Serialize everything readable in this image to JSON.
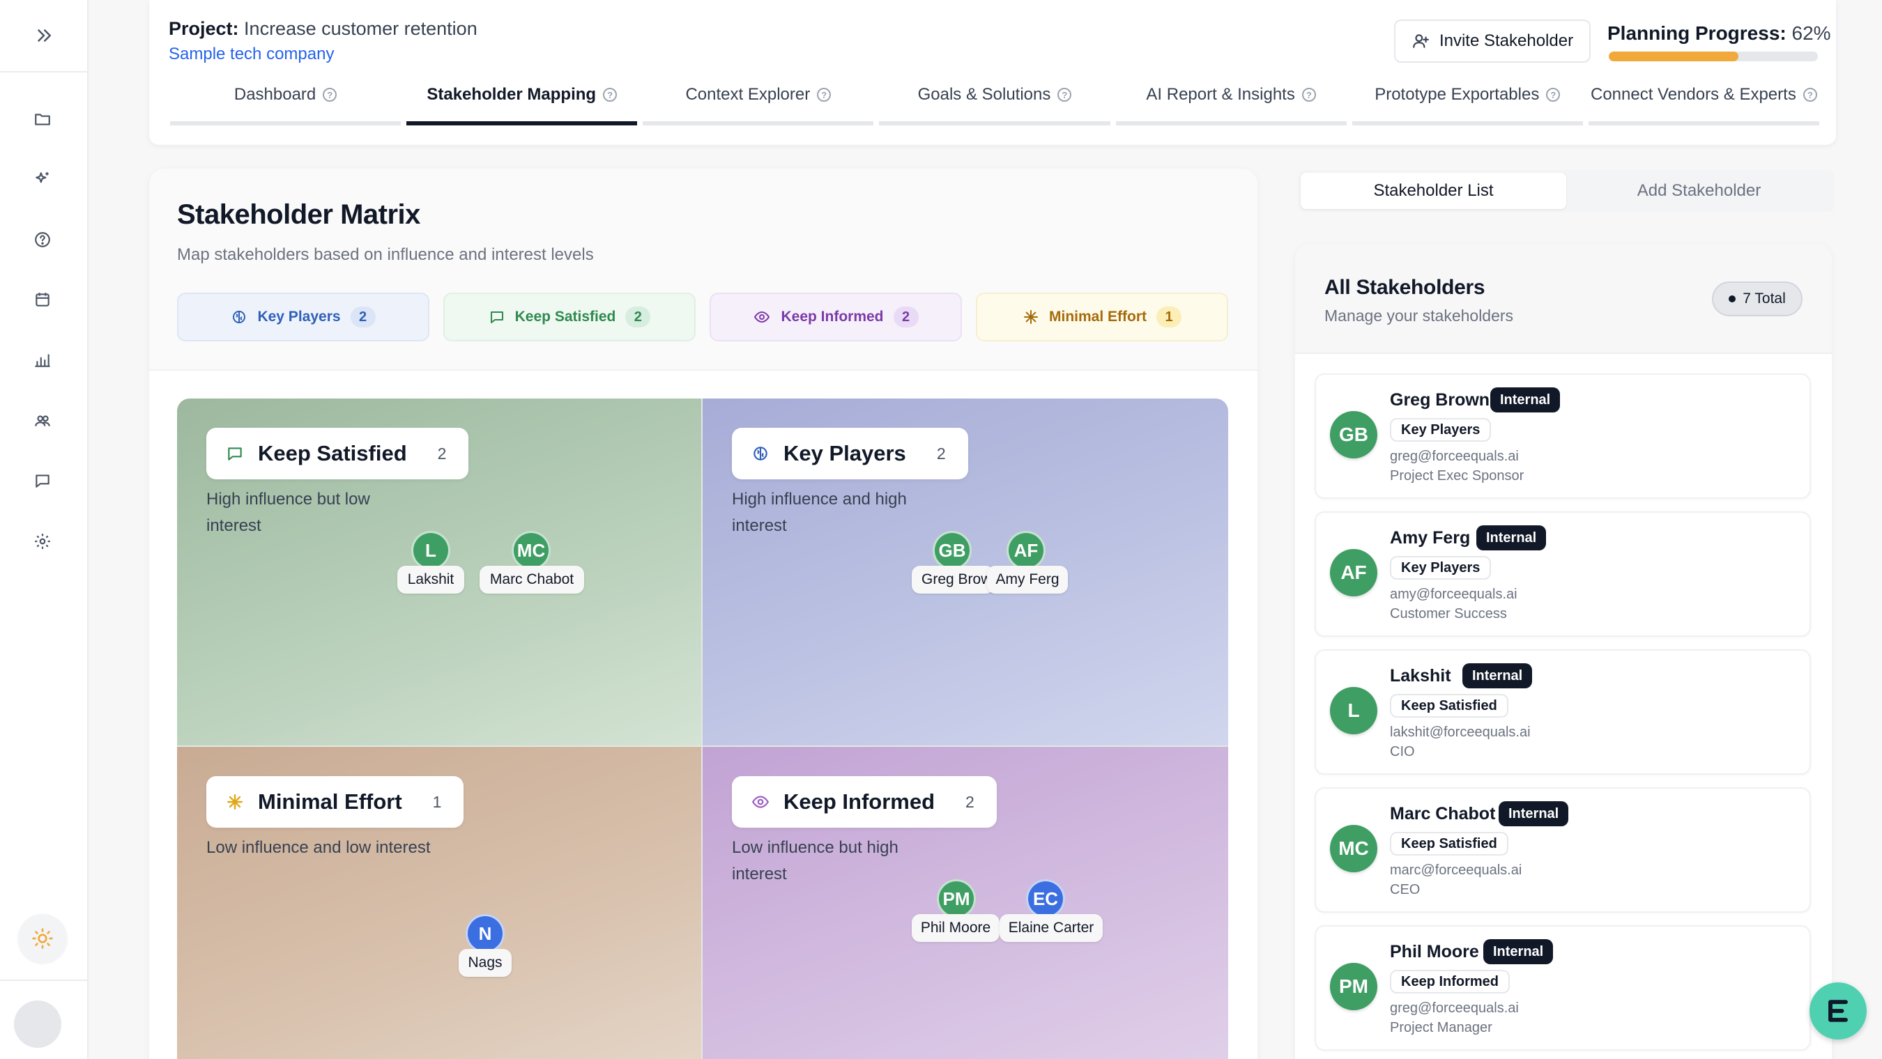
{
  "sidebar": {
    "items": [
      {
        "icon": "folder-icon"
      },
      {
        "icon": "sparkle-icon"
      },
      {
        "icon": "help-icon"
      },
      {
        "icon": "calendar-icon"
      },
      {
        "icon": "bar-chart-icon"
      },
      {
        "icon": "users-icon"
      },
      {
        "icon": "chat-icon"
      },
      {
        "icon": "settings-icon"
      }
    ]
  },
  "header": {
    "project_label": "Project:",
    "project_name": "Increase customer retention",
    "company": "Sample tech company",
    "invite_label": "Invite Stakeholder",
    "progress_label": "Planning Progress:",
    "progress_value": "62%",
    "progress_fraction": 0.62,
    "progress_color": "#f0a93a"
  },
  "tabs": [
    {
      "label": "Dashboard",
      "active": false
    },
    {
      "label": "Stakeholder Mapping",
      "active": true
    },
    {
      "label": "Context Explorer",
      "active": false
    },
    {
      "label": "Goals & Solutions",
      "active": false
    },
    {
      "label": "AI Report & Insights",
      "active": false
    },
    {
      "label": "Prototype Exportables",
      "active": false
    },
    {
      "label": "Connect Vendors & Experts",
      "active": false
    }
  ],
  "matrix": {
    "title": "Stakeholder Matrix",
    "subtitle": "Map stakeholders based on influence and interest levels",
    "pills": [
      {
        "label": "Key Players",
        "count": "2",
        "color": "#2f5fb8",
        "bg": "#eef3fb",
        "border": "#dde6f5",
        "cnt_bg": "#dbe5f7"
      },
      {
        "label": "Keep Satisfied",
        "count": "2",
        "color": "#2f8a4e",
        "bg": "#eff8f1",
        "border": "#dff0e3",
        "cnt_bg": "#d6ede0"
      },
      {
        "label": "Keep Informed",
        "count": "2",
        "color": "#7b3aa8",
        "bg": "#f6f0fb",
        "border": "#ebe1f4",
        "cnt_bg": "#e9dbf5"
      },
      {
        "label": "Minimal Effort",
        "count": "1",
        "color": "#a66a0b",
        "bg": "#fefbea",
        "border": "#f6efcf",
        "cnt_bg": "#fbeeb6"
      }
    ],
    "quadrants": {
      "keep_satisfied": {
        "title": "Keep Satisfied",
        "count": "2",
        "desc": "High influence but low interest",
        "people": [
          {
            "initials": "L",
            "name": "Lakshit"
          },
          {
            "initials": "MC",
            "name": "Marc Chabot"
          }
        ]
      },
      "key_players": {
        "title": "Key Players",
        "count": "2",
        "desc": "High influence and high interest",
        "people": [
          {
            "initials": "GB",
            "name": "Greg Brown"
          },
          {
            "initials": "AF",
            "name": "Amy Ferg"
          }
        ]
      },
      "minimal_effort": {
        "title": "Minimal Effort",
        "count": "1",
        "desc": "Low influence and low interest",
        "people": [
          {
            "initials": "N",
            "name": "Nags"
          }
        ]
      },
      "keep_informed": {
        "title": "Keep Informed",
        "count": "2",
        "desc": "Low influence but high interest",
        "people": [
          {
            "initials": "PM",
            "name": "Phil Moore"
          },
          {
            "initials": "EC",
            "name": "Elaine Carter"
          }
        ]
      }
    }
  },
  "right_panel": {
    "tabs": [
      {
        "label": "Stakeholder List",
        "active": true
      },
      {
        "label": "Add Stakeholder",
        "active": false
      }
    ],
    "title": "All Stakeholders",
    "subtitle": "Manage your stakeholders",
    "total_badge": "7 Total",
    "stakeholders": [
      {
        "initials": "GB",
        "name": "Greg Brown",
        "tag": "Internal",
        "category": "Key Players",
        "email": "greg@forceequals.ai",
        "role": "Project Exec Sponsor"
      },
      {
        "initials": "AF",
        "name": "Amy Ferg",
        "tag": "Internal",
        "category": "Key Players",
        "email": "amy@forceequals.ai",
        "role": "Customer Success"
      },
      {
        "initials": "L",
        "name": "Lakshit",
        "tag": "Internal",
        "category": "Keep Satisfied",
        "email": "lakshit@forceequals.ai",
        "role": "CIO"
      },
      {
        "initials": "MC",
        "name": "Marc Chabot",
        "tag": "Internal",
        "category": "Keep Satisfied",
        "email": "marc@forceequals.ai",
        "role": "CEO"
      },
      {
        "initials": "PM",
        "name": "Phil Moore",
        "tag": "Internal",
        "category": "Keep Informed",
        "email": "greg@forceequals.ai",
        "role": "Project Manager"
      }
    ]
  }
}
